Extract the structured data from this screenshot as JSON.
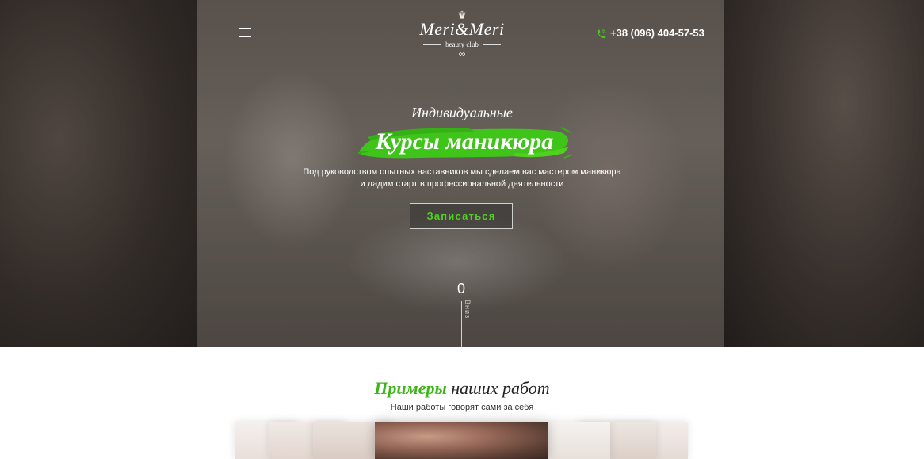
{
  "header": {
    "logo": {
      "name": "Meri&Meri",
      "tagline": "beauty club"
    },
    "menu_icon": "hamburger-icon",
    "phone": {
      "icon": "phone-icon",
      "number": "+38 (096) 404-57-53"
    }
  },
  "hero": {
    "subtitle": "Индивидуальные",
    "title": "Курсы маникюра",
    "lead_line1": "Под руководством опытных наставников мы сделаем вас мастером маникюра",
    "lead_line2": "и дадим старт в профессиональной деятельности",
    "cta_label": "Записаться",
    "scroll_counter": "0",
    "scroll_label": "Вниз"
  },
  "works": {
    "title_accent": "Примеры",
    "title_rest": "наших работ",
    "subtitle": "Наши работы говорят сами за себя"
  },
  "colors": {
    "accent": "#3fb51a",
    "cta_text": "#4fd11e"
  }
}
